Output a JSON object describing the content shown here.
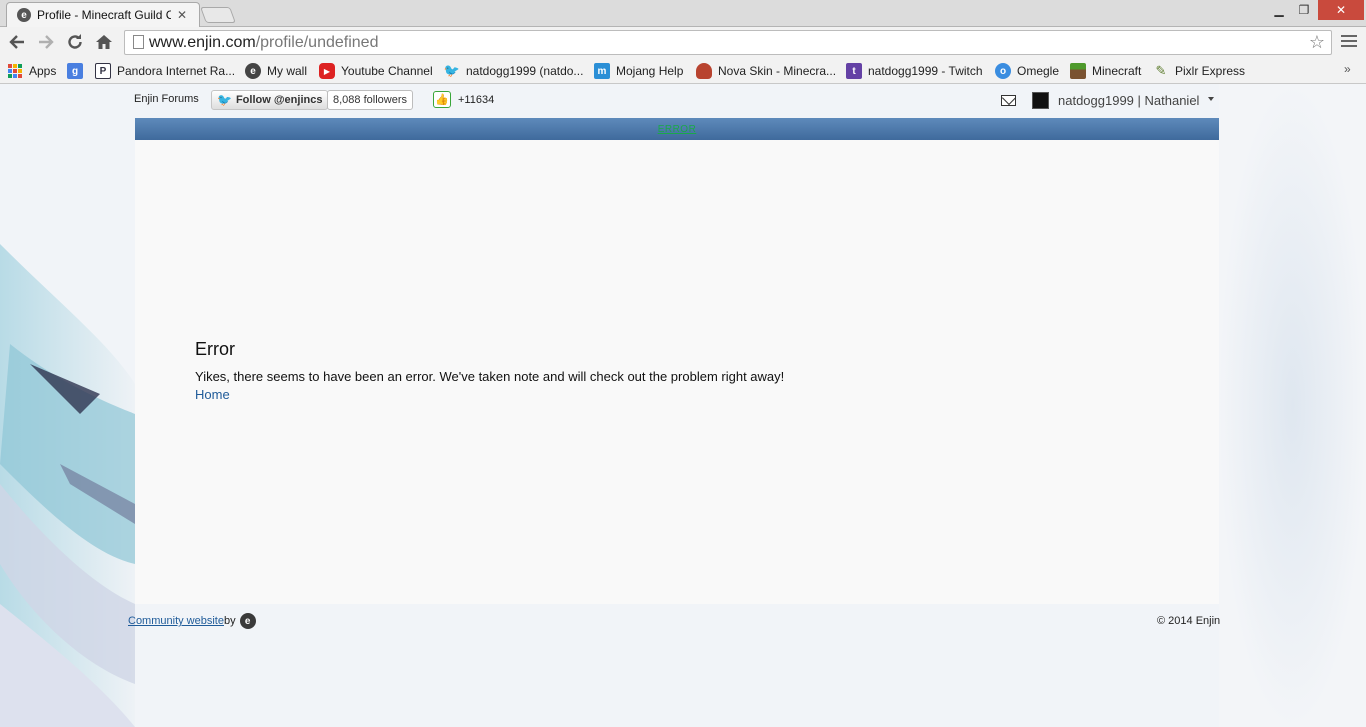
{
  "browser": {
    "tab_title": "Profile - Minecraft Guild C",
    "tab_close": "✕",
    "url_host": "www.enjin.com",
    "url_path": "/profile/undefined",
    "bookmarks": [
      {
        "label": "Apps",
        "icon": "apps-grid-icon"
      },
      {
        "label": "",
        "icon": "google-icon"
      },
      {
        "label": "Pandora Internet Ra...",
        "icon": "pandora-icon"
      },
      {
        "label": "My wall",
        "icon": "enjin-icon"
      },
      {
        "label": "Youtube Channel",
        "icon": "youtube-icon"
      },
      {
        "label": "natdogg1999 (natdo...",
        "icon": "twitter-icon"
      },
      {
        "label": "Mojang Help",
        "icon": "mojang-icon"
      },
      {
        "label": "Nova Skin - Minecra...",
        "icon": "novaskin-icon"
      },
      {
        "label": "natdogg1999 - Twitch",
        "icon": "twitch-icon"
      },
      {
        "label": "Omegle",
        "icon": "omegle-icon"
      },
      {
        "label": "Minecraft",
        "icon": "minecraft-icon"
      },
      {
        "label": "Pixlr Express",
        "icon": "pixlr-icon"
      }
    ],
    "more": "»"
  },
  "topbar": {
    "forums": "Enjin Forums",
    "follow": "Follow @enjincs",
    "followers": "8,088 followers",
    "points": "+11634",
    "username": "natdogg1999 | Nathaniel"
  },
  "navbar": {
    "item": "ERROR"
  },
  "error": {
    "title": "Error",
    "message": "Yikes, there seems to have been an error. We've taken note and will check out the problem right away!",
    "home": "Home"
  },
  "footer": {
    "community": "Community website ",
    "by": " by",
    "copyright": "© 2014 Enjin"
  },
  "colors": {
    "navbar": "#4a76a8",
    "error_link": "#1aa84a",
    "link": "#1f5b99",
    "close_button": "#c94a3d"
  }
}
